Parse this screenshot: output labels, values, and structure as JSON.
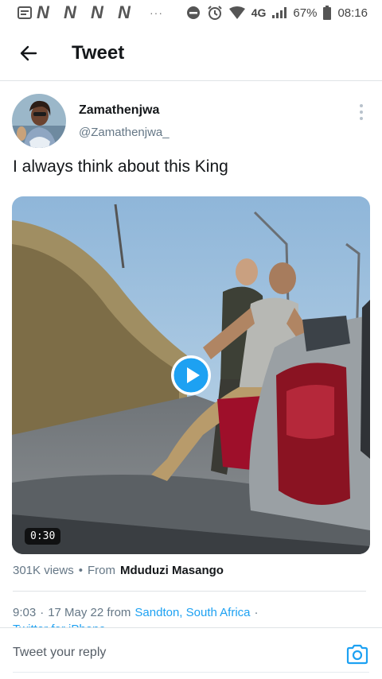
{
  "status_bar": {
    "left_badges": [
      "N",
      "N",
      "N",
      "N"
    ],
    "dots": "···",
    "network": "4G",
    "battery": "67%",
    "time": "08:16"
  },
  "header": {
    "title": "Tweet"
  },
  "tweet": {
    "display_name": "Zamathenjwa",
    "handle": "@Zamathenjwa_",
    "text": "I always think about this King",
    "media": {
      "duration": "0:30"
    },
    "views": "301K views",
    "from_label": "From",
    "from_name": "Mduduzi Masango",
    "time": "9:03",
    "date": "17 May 22 from",
    "location": "Sandton, South Africa",
    "client": "Twitter for iPhone",
    "separator": "·"
  },
  "reply": {
    "placeholder": "Tweet your reply"
  },
  "colors": {
    "accent": "#1da1f2",
    "secondary_text": "#657786"
  }
}
